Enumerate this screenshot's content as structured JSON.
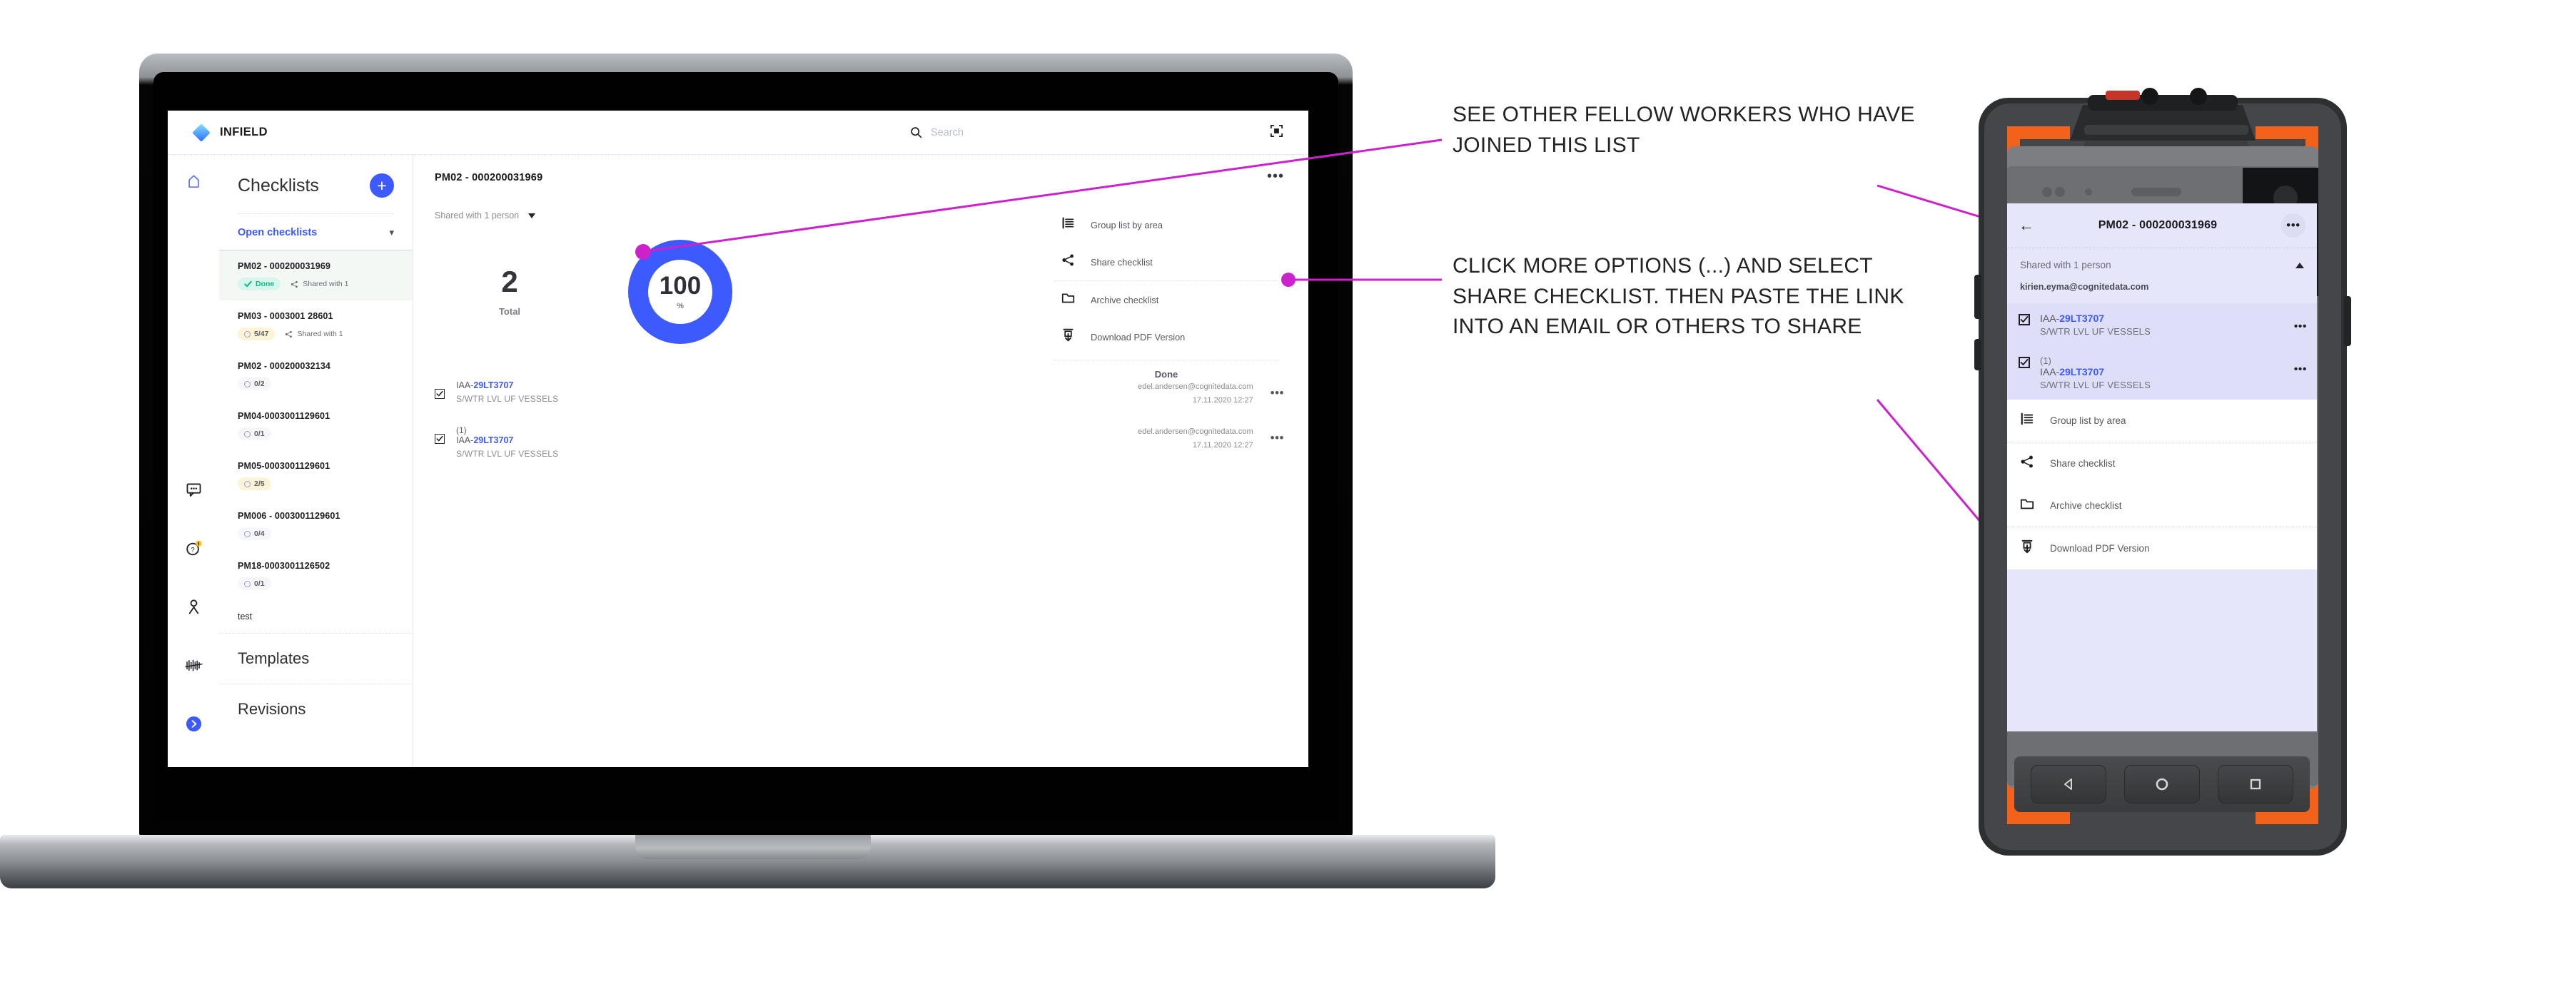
{
  "app": {
    "brand": "INFIELD",
    "search_placeholder": "Search",
    "search_icon": "search-icon",
    "expand_icon": "fullscreen-icon",
    "logo_icon": "infield-diamond-logo"
  },
  "rail": {
    "items": [
      {
        "icon": "home-icon"
      },
      {
        "icon": "chat-bubble-icon"
      },
      {
        "icon": "help-alert-icon"
      },
      {
        "icon": "person-icon"
      },
      {
        "icon": "tune-icon"
      },
      {
        "icon": "chevron-right-circle-icon"
      }
    ]
  },
  "sidebar": {
    "title": "Checklists",
    "add_label": "+",
    "group_label": "Open checklists",
    "group_caret": "chevron-down-icon",
    "items": [
      {
        "name": "PM02 - 000200031969",
        "status": "Done",
        "status_type": "done",
        "shared": "Shared with 1",
        "active": true
      },
      {
        "name": "PM03 - 0003001 28601",
        "status": "5/47",
        "status_type": "progress",
        "shared": "Shared with 1",
        "active": false
      },
      {
        "name": "PM02 - 000200032134",
        "status": "0/2",
        "status_type": "zero",
        "shared": "",
        "active": false
      },
      {
        "name": "PM04-0003001129601",
        "status": "0/1",
        "status_type": "zero",
        "shared": "",
        "active": false
      },
      {
        "name": "PM05-0003001129601",
        "status": "2/5",
        "status_type": "progress",
        "shared": "",
        "active": false
      },
      {
        "name": "PM006 - 0003001129601",
        "status": "0/4",
        "status_type": "zero",
        "shared": "",
        "active": false
      },
      {
        "name": "PM18-0003001126502",
        "status": "0/1",
        "status_type": "zero",
        "shared": "",
        "active": false
      }
    ],
    "plain_item": "test",
    "templates_label": "Templates",
    "revisions_label": "Revisions"
  },
  "main": {
    "title": "PM02 - 000200031969",
    "kebab": "•••",
    "shared_text": "Shared with 1 person",
    "stats": {
      "total_value": "2",
      "total_label": "Total"
    },
    "progress": {
      "value": "100",
      "unit": "%",
      "percent": 100,
      "color": "#3d5afe"
    },
    "menu": {
      "items": [
        {
          "label": "Group list by area",
          "icon": "group-list-icon"
        },
        {
          "label": "Share checklist",
          "icon": "share-icon"
        },
        {
          "label": "Archive checklist",
          "icon": "folder-icon"
        },
        {
          "label": "Download PDF Version",
          "icon": "download-icon"
        }
      ],
      "done_label": "Done"
    },
    "rows": [
      {
        "tag": "",
        "prefix": "IAA-",
        "code": "29LT3707",
        "sub": "S/WTR LVL UF VESSELS",
        "email": "edel.andersen@cognitedata.com",
        "timestamp": "17.11.2020 12:27",
        "checked": true
      },
      {
        "tag": "(1)",
        "prefix": "IAA-",
        "code": "29LT3707",
        "sub": "S/WTR LVL UF VESSELS",
        "email": "edel.andersen@cognitedata.com",
        "timestamp": "17.11.2020 12:27",
        "checked": true
      }
    ]
  },
  "annotations": [
    {
      "text": "SEE OTHER FELLOW WORKERS WHO HAVE JOINED THIS LIST"
    },
    {
      "text": "CLICK MORE OPTIONS (...) AND SELECT SHARE CHECKLIST. THEN PASTE THE LINK INTO AN EMAIL OR OTHERS TO SHARE"
    }
  ],
  "annotation_color": "#cc22cc",
  "phone": {
    "title": "PM02 - 000200031969",
    "back_icon": "arrow-left-icon",
    "kebab": "•••",
    "shared_text": "Shared with 1 person",
    "shared_caret": "chevron-up-icon",
    "email": "kirien.eyma@cognitedata.com",
    "rows": [
      {
        "tag": "",
        "prefix": "IAA-",
        "code": "29LT3707",
        "sub": "S/WTR LVL UF VESSELS",
        "checked": true
      },
      {
        "tag": "(1)",
        "prefix": "IAA-",
        "code": "29LT3707",
        "sub": "S/WTR LVL UF VESSELS",
        "checked": true
      }
    ],
    "menu": [
      {
        "label": "Group list by area",
        "icon": "group-list-icon"
      },
      {
        "label": "Share checklist",
        "icon": "share-icon"
      },
      {
        "label": "Archive checklist",
        "icon": "folder-icon"
      },
      {
        "label": "Download PDF Version",
        "icon": "download-icon"
      }
    ],
    "nav": [
      {
        "icon": "android-back-icon"
      },
      {
        "icon": "android-home-icon"
      },
      {
        "icon": "android-recents-icon"
      }
    ]
  }
}
